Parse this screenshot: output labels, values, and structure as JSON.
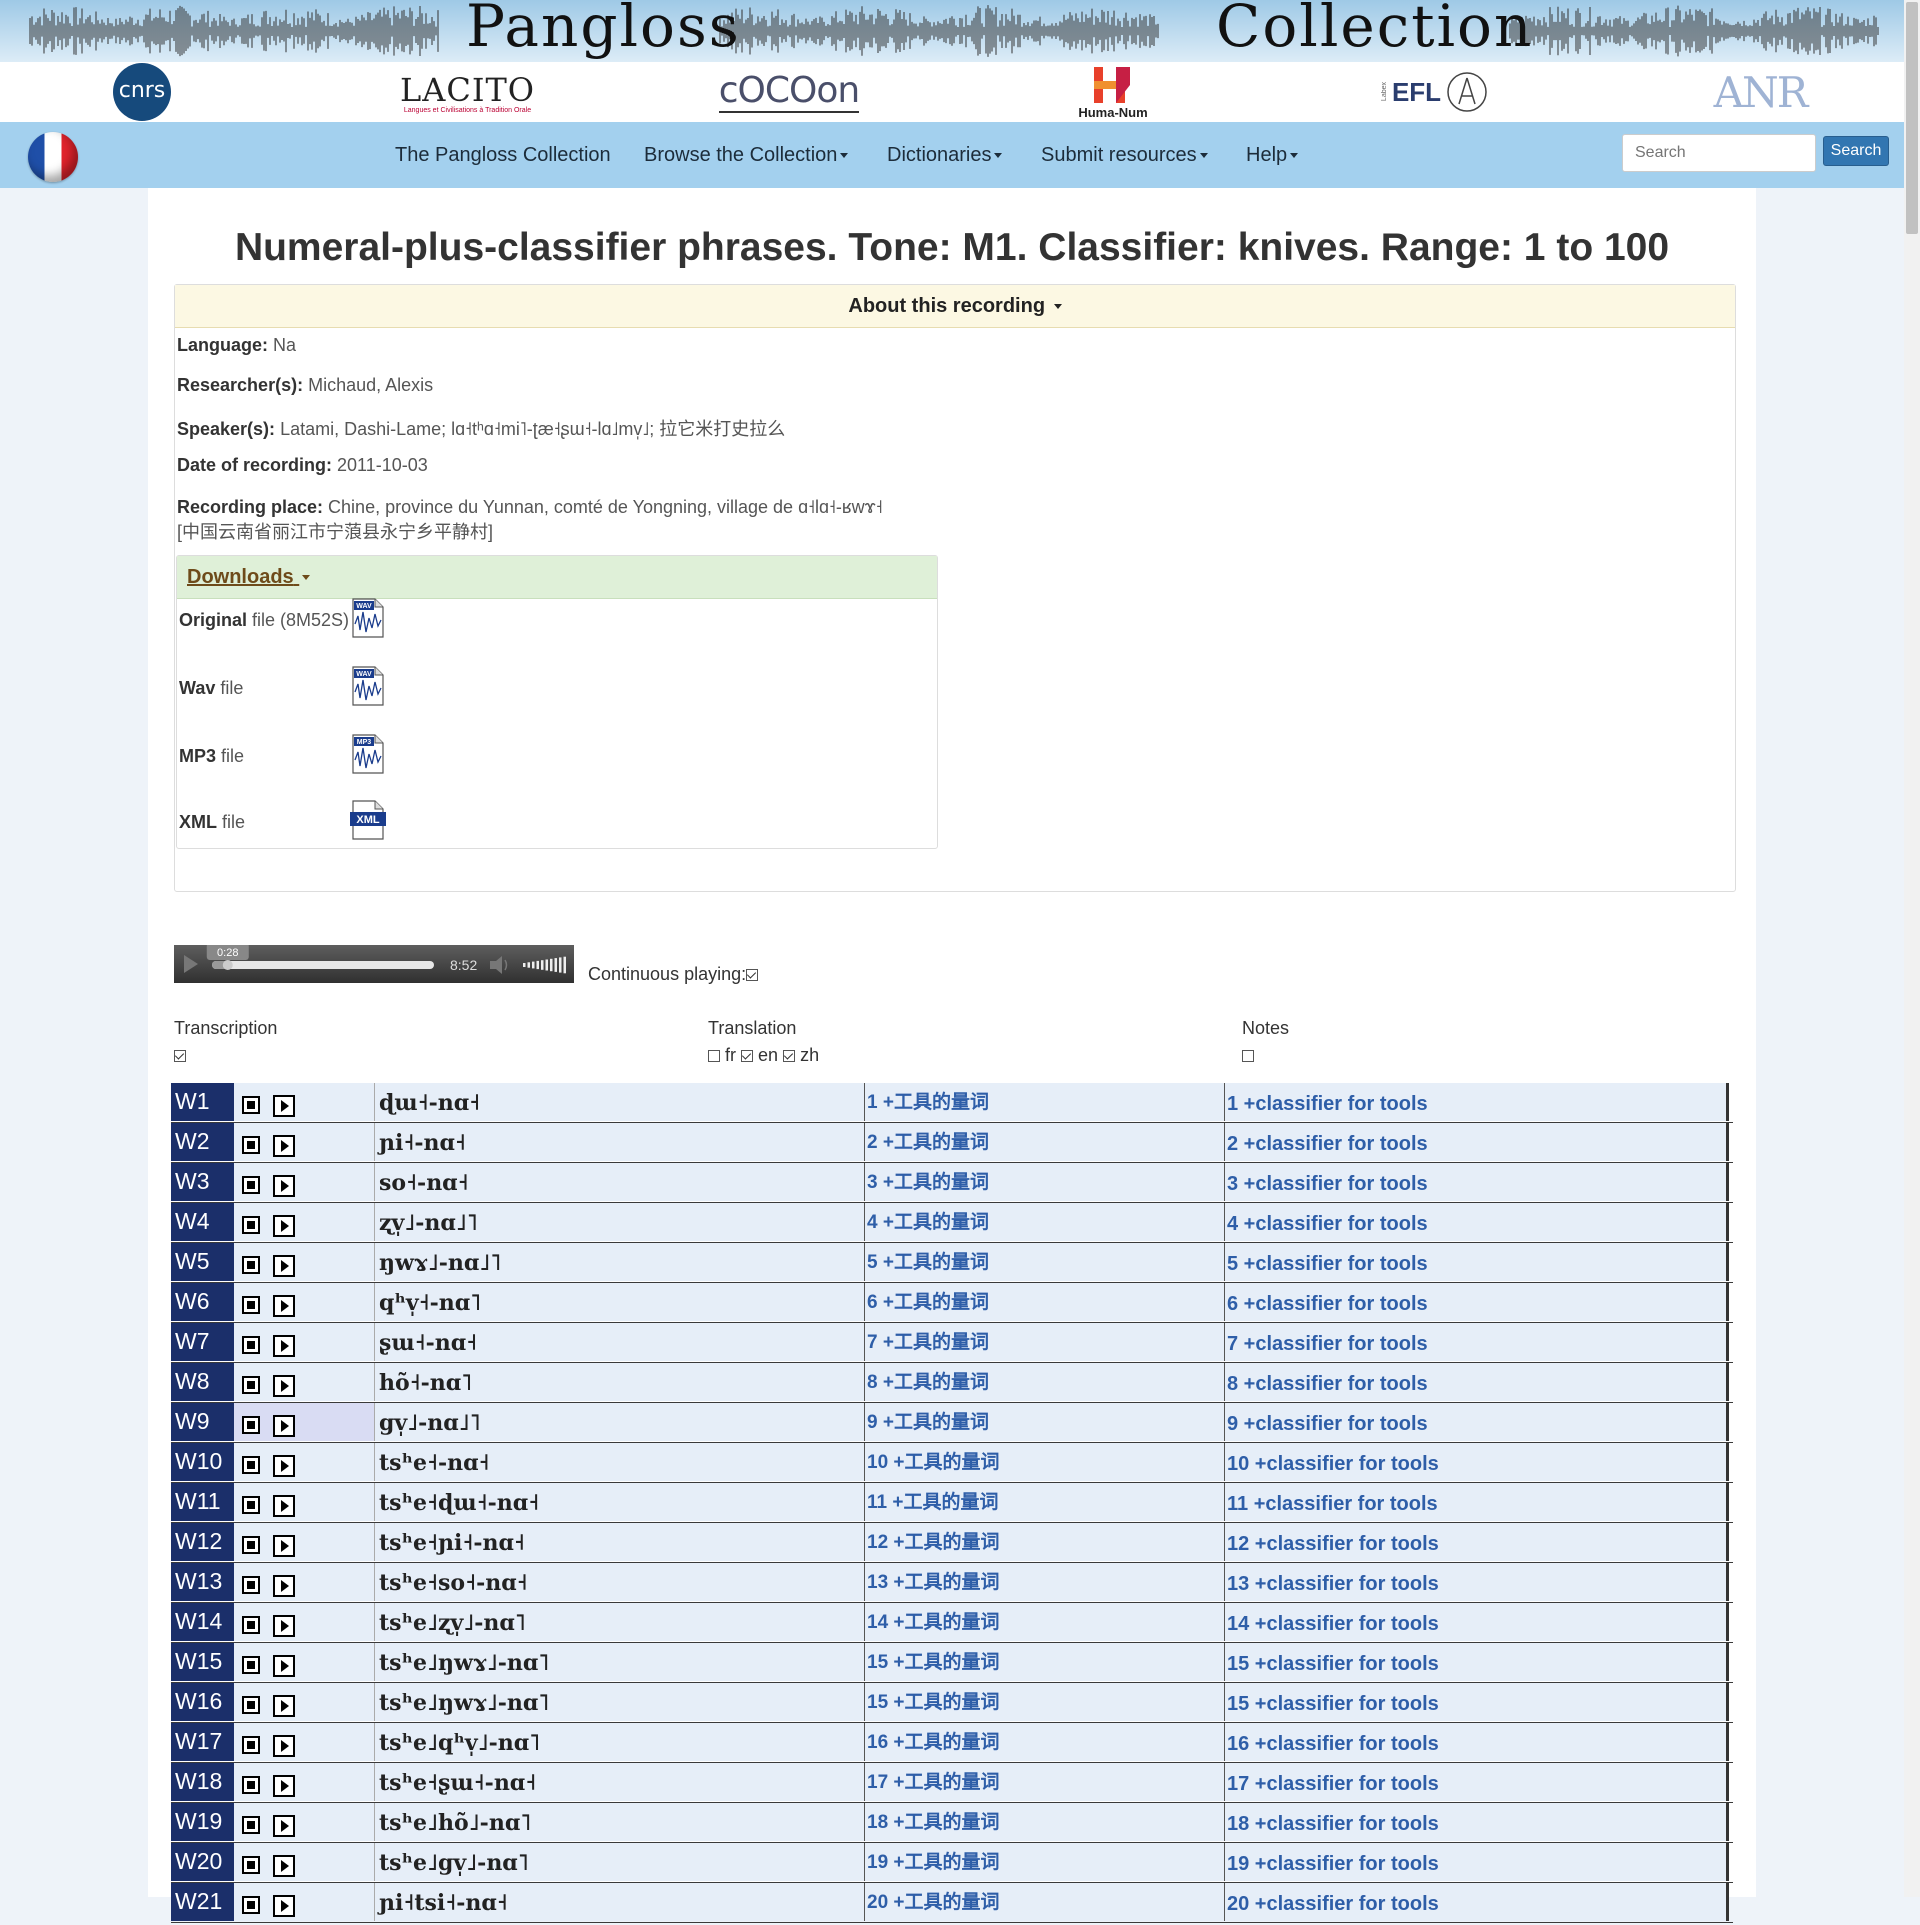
{
  "banner": {
    "title_left": "Pangloss",
    "title_right": "Collection"
  },
  "logos": {
    "cnrs": "cnrs",
    "lacito": "LACITO",
    "lacito_ring": "Langues et Civilisations à Tradition Orale",
    "cocoon": "cOCOon",
    "humanum": "Huma-Num",
    "efl": "EFL",
    "labex": "Labex",
    "anr": "ANR"
  },
  "nav": {
    "items": [
      {
        "label": "The Pangloss Collection",
        "dropdown": false
      },
      {
        "label": "Browse the Collection",
        "dropdown": true
      },
      {
        "label": "Dictionaries",
        "dropdown": true
      },
      {
        "label": "Submit resources",
        "dropdown": true
      },
      {
        "label": "Help",
        "dropdown": true
      }
    ],
    "search_placeholder": "Search",
    "search_button": "Search"
  },
  "page": {
    "title": "Numeral-plus-classifier phrases. Tone: M1. Classifier: knives. Range: 1 to 100"
  },
  "about": {
    "heading": "About this recording",
    "language_label": "Language:",
    "language": "Na",
    "researcher_label": "Researcher(s):",
    "researcher": "Michaud, Alexis",
    "speaker_label": "Speaker(s):",
    "speaker": "Latami, Dashi-Lame; lɑ˧tʰɑ˧mi˥-ʈæ˧ʂɯ˧-lɑ˩mv̩˩; 拉它米打史拉么",
    "date_label": "Date of recording:",
    "date": "2011-10-03",
    "place_label": "Recording place:",
    "place_line1": "Chine, province du Yunnan, comté de Yongning, village de ɑ˧lɑ˧-ʁwɤ˧",
    "place_line2": "[中国云南省丽江市宁蒗县永宁乡平静村]"
  },
  "downloads": {
    "heading": "Downloads",
    "files": [
      {
        "bold": "Original",
        "rest": " file (8M52S)",
        "icon": "wav-file-icon",
        "tag": "WAV"
      },
      {
        "bold": "Wav",
        "rest": " file",
        "icon": "wav-file-icon",
        "tag": "WAV"
      },
      {
        "bold": "MP3",
        "rest": " file",
        "icon": "mp3-file-icon",
        "tag": "MP3"
      },
      {
        "bold": "XML",
        "rest": " file",
        "icon": "xml-file-icon",
        "tag": "XML"
      }
    ]
  },
  "player": {
    "current_time": "0:28",
    "duration": "8:52",
    "progress": 0.053,
    "continuous_label": "Continuous playing:",
    "continuous_checked": true
  },
  "columns": {
    "transcription": "Transcription",
    "translation": "Translation",
    "notes": "Notes",
    "lang_fr": "fr",
    "lang_en": "en",
    "lang_zh": "zh"
  },
  "rows": [
    {
      "id": "W1",
      "form": "ɖɯ˧-nɑ˧",
      "zh": "1 +工具的量词",
      "en": "1 +classifier for tools"
    },
    {
      "id": "W2",
      "form": "ɲi˧-nɑ˧",
      "zh": "2 +工具的量词",
      "en": "2 +classifier for tools"
    },
    {
      "id": "W3",
      "form": "so˧-nɑ˧",
      "zh": "3 +工具的量词",
      "en": "3 +classifier for tools"
    },
    {
      "id": "W4",
      "form": "ʐv̩˩-nɑ˩˥",
      "zh": "4 +工具的量词",
      "en": "4 +classifier for tools"
    },
    {
      "id": "W5",
      "form": "ŋwɤ˩-nɑ˩˥",
      "zh": "5 +工具的量词",
      "en": "5 +classifier for tools"
    },
    {
      "id": "W6",
      "form": "qʰv̩˧-nɑ˥",
      "zh": "6 +工具的量词",
      "en": "6 +classifier for tools"
    },
    {
      "id": "W7",
      "form": "ʂɯ˧-nɑ˧",
      "zh": "7 +工具的量词",
      "en": "7 +classifier for tools"
    },
    {
      "id": "W8",
      "form": "hõ˧-nɑ˥",
      "zh": "8 +工具的量词",
      "en": "8 +classifier for tools"
    },
    {
      "id": "W9",
      "form": "gv̩˩-nɑ˩˥",
      "zh": "9 +工具的量词",
      "en": "9 +classifier for tools"
    },
    {
      "id": "W10",
      "form": "tsʰe˧-nɑ˧",
      "zh": "10 +工具的量词",
      "en": "10 +classifier for tools"
    },
    {
      "id": "W11",
      "form": "tsʰe˧ɖɯ˧-nɑ˧",
      "zh": "11 +工具的量词",
      "en": "11 +classifier for tools"
    },
    {
      "id": "W12",
      "form": "tsʰe˧ɲi˧-nɑ˧",
      "zh": "12 +工具的量词",
      "en": "12 +classifier for tools"
    },
    {
      "id": "W13",
      "form": "tsʰe˧so˧-nɑ˧",
      "zh": "13 +工具的量词",
      "en": "13 +classifier for tools"
    },
    {
      "id": "W14",
      "form": "tsʰe˩ʐv̩˩-nɑ˥",
      "zh": "14 +工具的量词",
      "en": "14 +classifier for tools"
    },
    {
      "id": "W15",
      "form": "tsʰe˩ŋwɤ˩-nɑ˥",
      "zh": "15 +工具的量词",
      "en": "15 +classifier for tools"
    },
    {
      "id": "W16",
      "form": "tsʰe˩ŋwɤ˩-nɑ˥",
      "zh": "15 +工具的量词",
      "en": "15 +classifier for tools"
    },
    {
      "id": "W17",
      "form": "tsʰe˩qʰv̩˩-nɑ˥",
      "zh": "16 +工具的量词",
      "en": "16 +classifier for tools"
    },
    {
      "id": "W18",
      "form": "tsʰe˧ʂɯ˧-nɑ˧",
      "zh": "17 +工具的量词",
      "en": "17 +classifier for tools"
    },
    {
      "id": "W19",
      "form": "tsʰe˩hõ˩-nɑ˥",
      "zh": "18 +工具的量词",
      "en": "18 +classifier for tools"
    },
    {
      "id": "W20",
      "form": "tsʰe˩gv̩˩-nɑ˥",
      "zh": "19 +工具的量词",
      "en": "19 +classifier for tools"
    },
    {
      "id": "W21",
      "form": "ɲi˧tsi˧-nɑ˧",
      "zh": "20 +工具的量词",
      "en": "20 +classifier for tools"
    }
  ],
  "colors": {
    "nav_bg": "#a3d0ee",
    "id_cell_bg": "#1b2f6a",
    "row_bg": "#e6eef8",
    "link_blue": "#2e5ea8",
    "about_bg": "#fcf8e3",
    "downloads_bg": "#dff0d8"
  }
}
